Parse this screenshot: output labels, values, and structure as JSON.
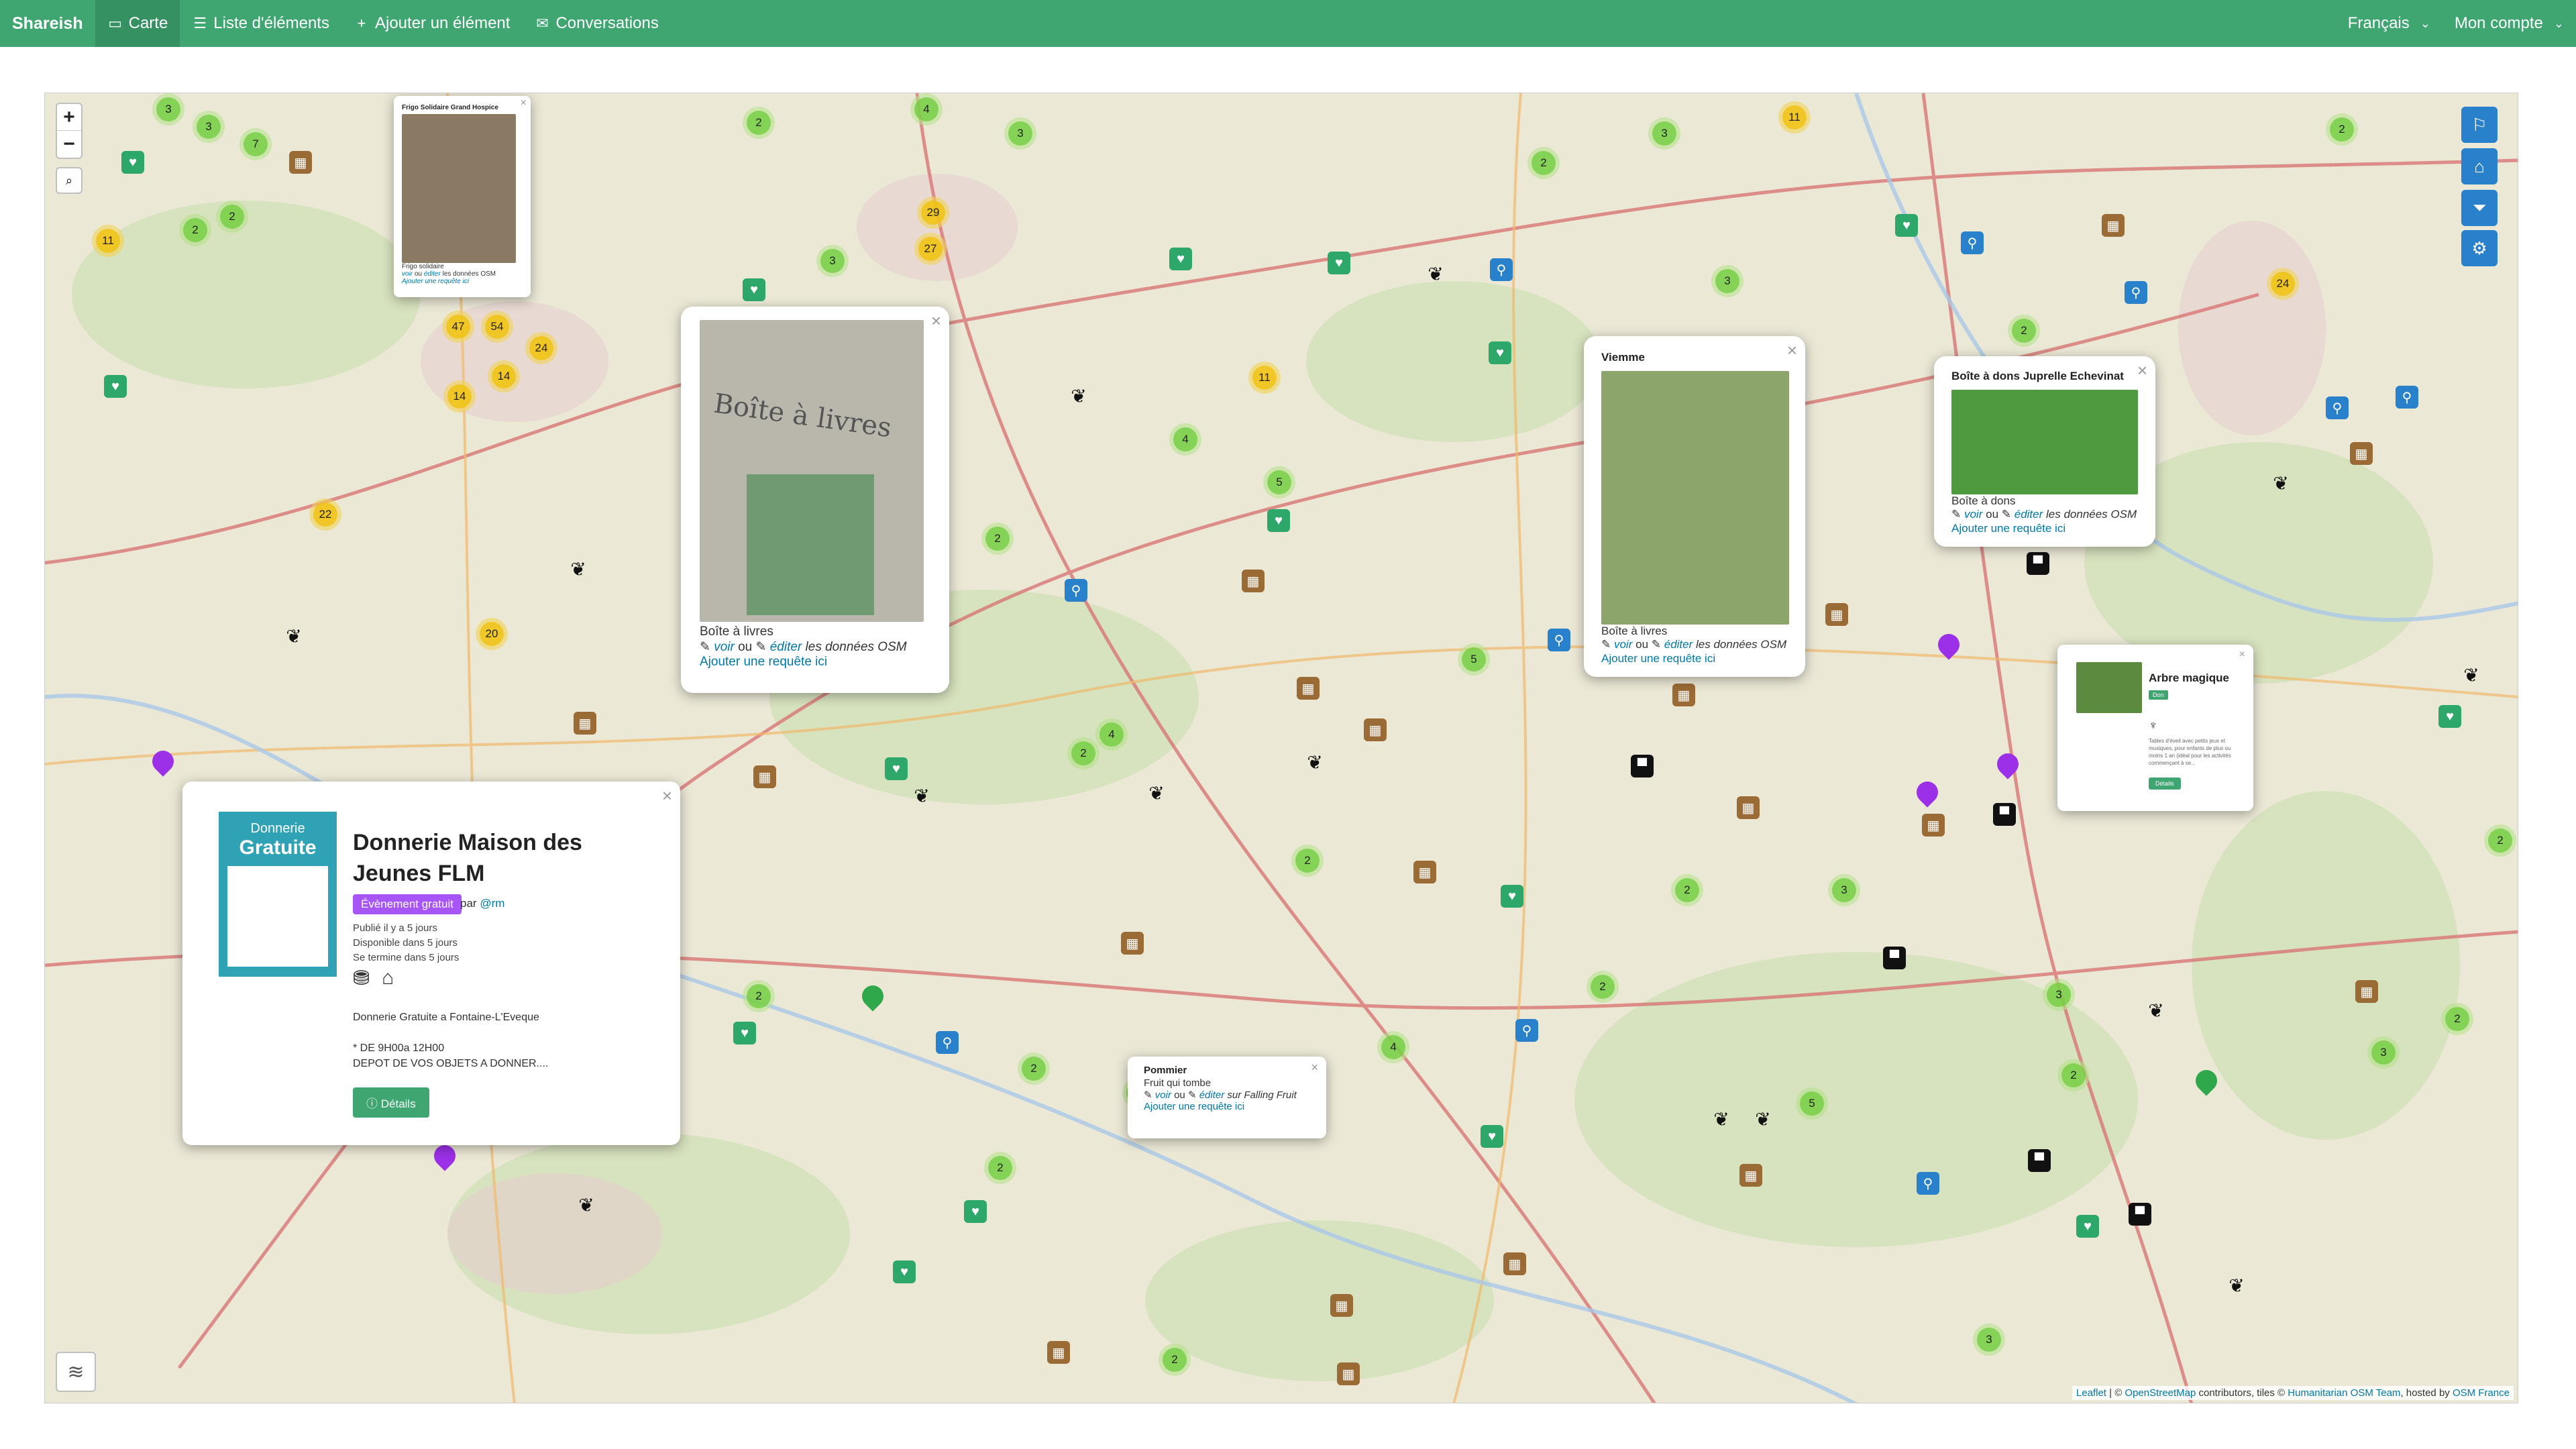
{
  "navbar": {
    "brand": "Shareish",
    "items": [
      {
        "icon": "map-icon",
        "label": "Carte"
      },
      {
        "icon": "list-icon",
        "label": "Liste d'éléments"
      },
      {
        "icon": "plus-icon",
        "label": "Ajouter un élément"
      },
      {
        "icon": "chat-icon",
        "label": "Conversations"
      }
    ],
    "language": "Français",
    "account": "Mon compte"
  },
  "map": {
    "attribution_leaflet": "Leaflet",
    "attribution_osm": "OpenStreetMap",
    "attribution_text1": "contributors, tiles ©",
    "attribution_hot": "Humanitarian OSM Team",
    "attribution_text2": ", hosted by",
    "attribution_host": "OSM France",
    "clusters": [
      {
        "n": "3"
      },
      {
        "n": "3"
      },
      {
        "n": "2"
      },
      {
        "n": "7"
      },
      {
        "n": "11"
      },
      {
        "n": "2"
      },
      {
        "n": "4"
      },
      {
        "n": "3"
      },
      {
        "n": "29"
      },
      {
        "n": "27"
      },
      {
        "n": "47"
      },
      {
        "n": "54"
      },
      {
        "n": "24"
      },
      {
        "n": "14"
      },
      {
        "n": "14"
      },
      {
        "n": "22"
      },
      {
        "n": "20"
      },
      {
        "n": "11"
      },
      {
        "n": "11"
      },
      {
        "n": "24"
      },
      {
        "n": "2"
      },
      {
        "n": "3"
      },
      {
        "n": "5"
      },
      {
        "n": "4"
      },
      {
        "n": "2"
      },
      {
        "n": "2"
      },
      {
        "n": "3"
      },
      {
        "n": "3"
      },
      {
        "n": "2"
      },
      {
        "n": "2"
      },
      {
        "n": "5"
      },
      {
        "n": "4"
      },
      {
        "n": "2"
      },
      {
        "n": "2"
      },
      {
        "n": "3"
      },
      {
        "n": "2"
      },
      {
        "n": "4"
      },
      {
        "n": "2"
      },
      {
        "n": "3"
      },
      {
        "n": "2"
      },
      {
        "n": "2"
      },
      {
        "n": "4"
      },
      {
        "n": "2"
      },
      {
        "n": "2"
      },
      {
        "n": "5"
      },
      {
        "n": "3"
      },
      {
        "n": "2"
      },
      {
        "n": "2"
      },
      {
        "n": "3"
      },
      {
        "n": "2"
      }
    ],
    "heart_markers": 18,
    "box_markers": 20,
    "fruit_markers": 14,
    "water_markers": 10
  },
  "popups": {
    "small_frigo": {
      "title": "Frigo Solidaire Grand Hospice",
      "category": "Frigo solidaire",
      "link_voir": "voir",
      "link_ou": "ou",
      "link_editer": "éditer",
      "link_data": "les données OSM",
      "add_request": "Ajouter une requête ici"
    },
    "boite_livres": {
      "photo_text": "Boîte à livres",
      "category": "Boîte à livres",
      "link_voir": "voir",
      "link_ou": "ou",
      "link_editer": "éditer",
      "link_data": "les données OSM",
      "add_request": "Ajouter une requête ici"
    },
    "vienme": {
      "title": "Viemme",
      "category": "Boîte à livres",
      "link_voir": "voir",
      "link_ou": "ou",
      "link_editer": "éditer",
      "link_data": "les données OSM",
      "add_request": "Ajouter une requête ici"
    },
    "jupr": {
      "title": "Boîte à dons Juprelle Echevinat",
      "category": "Boîte à dons",
      "link_voir": "voir",
      "link_ou": "ou",
      "link_editer": "éditer",
      "link_data": "les données OSM",
      "add_request": "Ajouter une requête ici"
    },
    "arbre": {
      "title": "Arbre magique",
      "badge": "Don",
      "text": "Tables d'éveil avec petits jeux et musiques, pour enfants de plus ou moins 1 an (idéal pour les activités commençant à se...",
      "button": "Détails"
    },
    "pommier": {
      "title": "Pommier",
      "category": "Fruit qui tombe",
      "link_voir": "voir",
      "link_ou": "ou",
      "link_editer": "éditer",
      "link_data": "sur Falling Fruit",
      "add_request": "Ajouter une requête ici"
    },
    "donnerie": {
      "poster_line1": "Donnerie",
      "poster_line2": "Gratuite",
      "title": "Donnerie Maison des Jeunes FLM",
      "badge": "Évènement gratuit",
      "by": "par",
      "user": "@rm",
      "published": "Publié il y a 5 jours",
      "available": "Disponible dans 5 jours",
      "ends": "Se termine dans 5 jours",
      "description": "Donnerie Gratuite a Fontaine-L'Eveque\n\n* DE 9H00a 12H00\nDEPOT DE VOS OBJETS A DONNER....",
      "button": "Détails"
    }
  }
}
